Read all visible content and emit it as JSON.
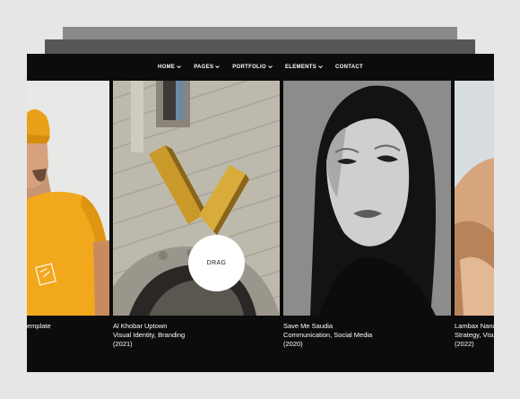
{
  "nav": {
    "items": [
      {
        "label": "HOME",
        "icon": "chevron-down-icon"
      },
      {
        "label": "PAGES",
        "icon": "chevron-down-icon"
      },
      {
        "label": "PORTFOLIO",
        "icon": "chevron-down-icon"
      },
      {
        "label": "ELEMENTS",
        "icon": "chevron-down-icon"
      },
      {
        "label": "CONTACT"
      }
    ]
  },
  "slides": [
    {
      "title": "emplate",
      "tags": "",
      "year": ""
    },
    {
      "title": "Al Khobar Uptown",
      "tags": "Visual Identity, Branding",
      "year": "(2021)"
    },
    {
      "title": "Save Me Saudia",
      "tags": "Communication, Social Media",
      "year": "(2020)"
    },
    {
      "title": "Lambax Nana",
      "tags": "Strategy, Visua",
      "year": "(2022)"
    }
  ],
  "cursor": {
    "label": "DRAG"
  },
  "colors": {
    "background": "#e6e6e6",
    "frame": "#0c0c0c",
    "accent_yellow": "#f2a81d",
    "text": "#ffffff"
  }
}
